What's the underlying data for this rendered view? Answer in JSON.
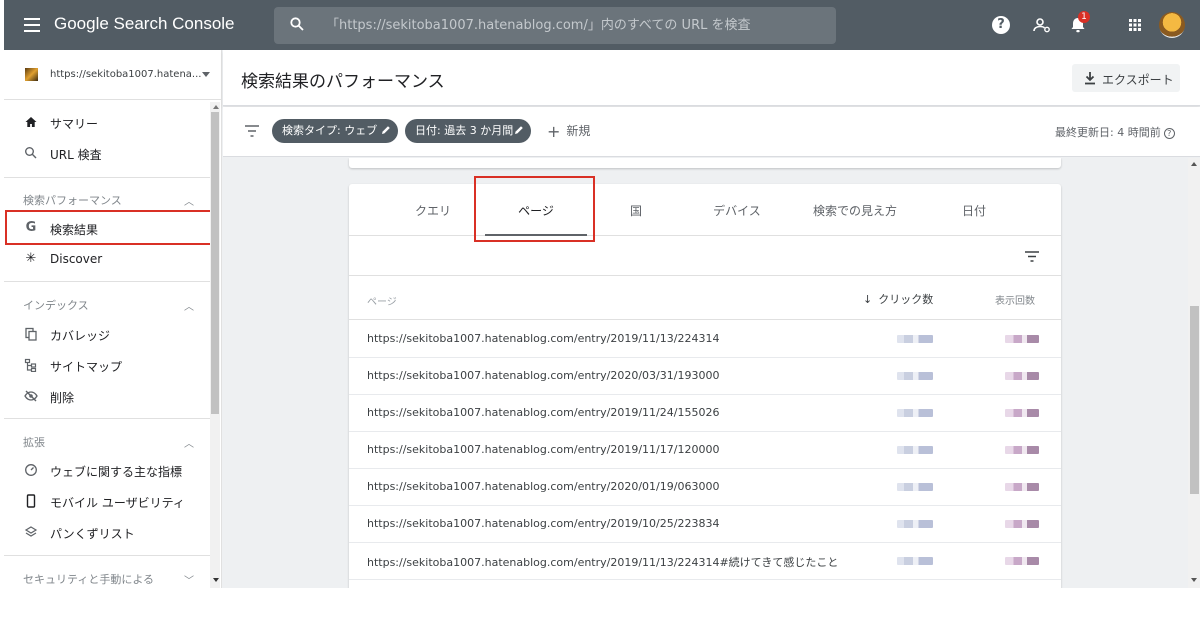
{
  "app": {
    "title": "Google Search Console"
  },
  "search": {
    "placeholder": "「https://sekitoba1007.hatenablog.com/」内のすべての URL を検査"
  },
  "topbar": {
    "notification_count": "1"
  },
  "property": {
    "label": "https://sekitoba1007.hatena..."
  },
  "sidebar": {
    "summary": "サマリー",
    "url_inspection": "URL 検査",
    "section_performance": "検索パフォーマンス",
    "search_results": "検索結果",
    "discover": "Discover",
    "section_index": "インデックス",
    "coverage": "カバレッジ",
    "sitemaps": "サイトマップ",
    "removals": "削除",
    "section_enhancements": "拡張",
    "core_web_vitals": "ウェブに関する主な指標",
    "mobile_usability": "モバイル ユーザビリティ",
    "breadcrumbs": "パンくずリスト",
    "section_security": "セキュリティと手動による"
  },
  "header": {
    "title": "検索結果のパフォーマンス",
    "export_label": "エクスポート"
  },
  "filters": {
    "search_type": "検索タイプ: ウェブ",
    "date": "日付: 過去 3 か月間",
    "new_label": "新規",
    "last_updated": "最終更新日: 4 時間前"
  },
  "tabs": [
    {
      "label": "クエリ"
    },
    {
      "label": "ページ"
    },
    {
      "label": "国"
    },
    {
      "label": "デバイス"
    },
    {
      "label": "検索での見え方"
    },
    {
      "label": "日付"
    }
  ],
  "table": {
    "columns": {
      "page": "ページ",
      "clicks": "クリック数",
      "impressions": "表示回数"
    },
    "rows": [
      {
        "url": "https://sekitoba1007.hatenablog.com/entry/2019/11/13/224314"
      },
      {
        "url": "https://sekitoba1007.hatenablog.com/entry/2020/03/31/193000"
      },
      {
        "url": "https://sekitoba1007.hatenablog.com/entry/2019/11/24/155026"
      },
      {
        "url": "https://sekitoba1007.hatenablog.com/entry/2019/11/17/120000"
      },
      {
        "url": "https://sekitoba1007.hatenablog.com/entry/2020/01/19/063000"
      },
      {
        "url": "https://sekitoba1007.hatenablog.com/entry/2019/10/25/223834"
      },
      {
        "url": "https://sekitoba1007.hatenablog.com/entry/2019/11/13/224314#続けてきて感じたこと"
      }
    ]
  },
  "colors": {
    "topbar": "#525c64",
    "highlight": "#d93025",
    "chip": "#525c64"
  }
}
